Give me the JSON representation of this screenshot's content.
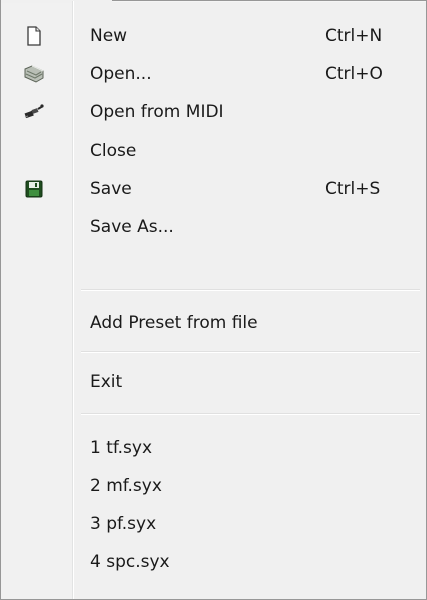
{
  "menu": {
    "items": [
      {
        "label": "New",
        "shortcut": "Ctrl+N",
        "icon": "new-file-icon"
      },
      {
        "label": "Open...",
        "shortcut": "Ctrl+O",
        "icon": "open-folder-icon"
      },
      {
        "label": "Open from MIDI",
        "shortcut": "",
        "icon": "midi-connector-icon"
      },
      {
        "label": "Close",
        "shortcut": "",
        "icon": ""
      },
      {
        "label": "Save",
        "shortcut": "Ctrl+S",
        "icon": "save-floppy-icon"
      },
      {
        "label": "Save As...",
        "shortcut": "",
        "icon": ""
      }
    ],
    "add_preset": {
      "label": "Add Preset from file"
    },
    "exit": {
      "label": "Exit"
    },
    "recent_files": [
      {
        "label": "1 tf.syx"
      },
      {
        "label": "2 mf.syx"
      },
      {
        "label": "3 pf.syx"
      },
      {
        "label": "4 spc.syx"
      }
    ]
  },
  "colors": {
    "menu_background": "#f0f0f0",
    "border": "#979797",
    "text": "#1a1a1a",
    "save_icon_green": "#2e7d32"
  }
}
